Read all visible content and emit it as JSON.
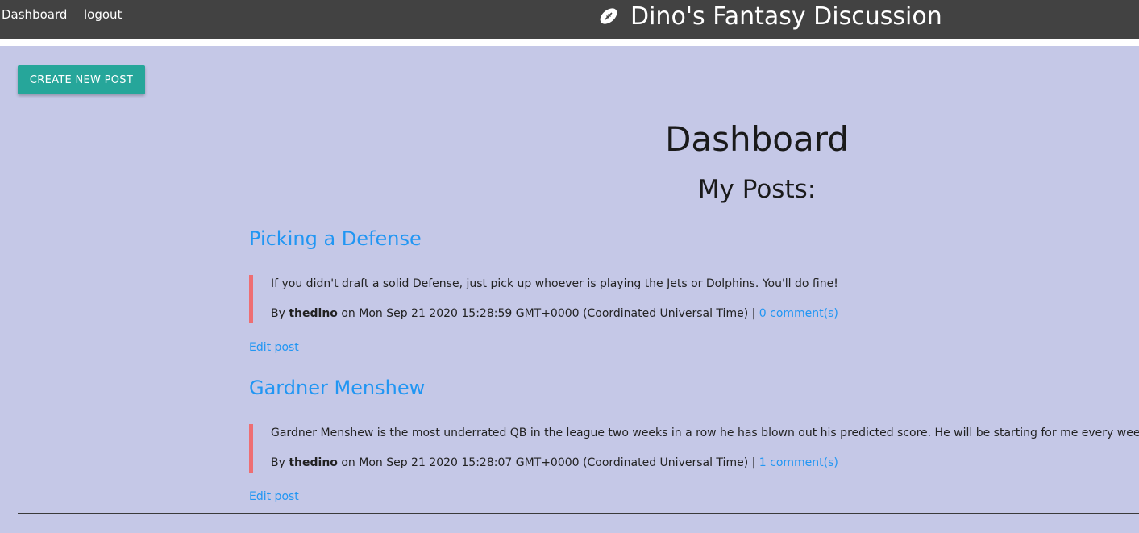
{
  "nav": {
    "dashboard_label": "Dashboard",
    "logout_label": "logout",
    "brand_title": "Dino's Fantasy Discussion",
    "brand_icon": "football-icon",
    "bg_color": "#424242"
  },
  "actions": {
    "create_post_label": "CREATE NEW POST",
    "accent_color": "#26a69a"
  },
  "main": {
    "title": "Dashboard",
    "subtitle": "My Posts:",
    "bg_color": "#c5c8e7"
  },
  "posts": [
    {
      "title": "Picking a Defense",
      "body": "If you didn't draft a solid Defense, just pick up whoever is playing the Jets or Dolphins. You'll do fine!",
      "by_label": "By",
      "author": "thedino",
      "date_text": "on Mon Sep 21 2020 15:28:59 GMT+0000 (Coordinated Universal Time) |",
      "comments": "0 comment(s)",
      "edit_label": "Edit post"
    },
    {
      "title": "Gardner Menshew",
      "body": "Gardner Menshew is the most underrated QB in the league two weeks in a row he has blown out his predicted score. He will be starting for me every week",
      "by_label": "By",
      "author": "thedino",
      "date_text": "on Mon Sep 21 2020 15:28:07 GMT+0000 (Coordinated Universal Time) |",
      "comments": "1 comment(s)",
      "edit_label": "Edit post"
    }
  ]
}
